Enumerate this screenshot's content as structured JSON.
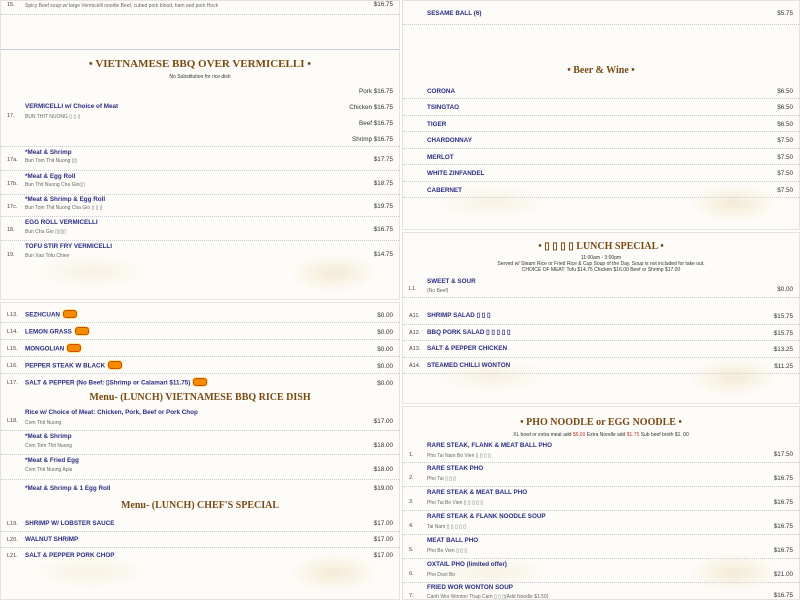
{
  "left_top": {
    "first_item": {
      "num": "15.",
      "desc": "Spicy Beef soup w/ large Vermicelli noodle Beef, cubed pork blood, ham and pork Hock",
      "price": "$16.75"
    },
    "section_title": "• VIETNAMESE BBQ OVER VERMICELLI •",
    "note": "No Substitution for rice dish",
    "item17": {
      "num": "17.",
      "name": "VERMICELLI w/ Choice of Meat",
      "sub": "BUN THIT NUONG ▯ ▯ ▯",
      "prices": [
        "Pork $16.75",
        "Chicken $16.75",
        "Beef $16.75",
        "Shrimp $16.75"
      ]
    },
    "items": [
      {
        "num": "17a.",
        "name": "*Meat & Shrimp",
        "sub": "Bun Tom Thit Nuong ▯▯",
        "price": "$17.75"
      },
      {
        "num": "17b.",
        "name": "*Meat & Egg Roll",
        "sub": "Bun Thit Nuong Cha Gio▯▯",
        "price": "$18.75"
      },
      {
        "num": "17c.",
        "name": "*Meat & Shrimp & Egg Roll",
        "sub": "Bun Tom Thit Nuong Cha Gio ▯ ▯ ▯",
        "price": "$19.75"
      },
      {
        "num": "18.",
        "name": "EGG ROLL VERMICELLI",
        "sub": "Bun Cha Gio ▯▯▯▯",
        "price": "$16.75"
      },
      {
        "num": "19.",
        "name": "TOFU STIR FRY VERMICELLI",
        "sub": "Bun Xao Tofu Chien",
        "price": "$14.75"
      }
    ]
  },
  "left_bottom": {
    "lunch_items": [
      {
        "num": "L13.",
        "name": "SEZHCUAN",
        "price": "$0.00",
        "hot": true
      },
      {
        "num": "L14.",
        "name": "LEMON GRASS",
        "price": "$0.00",
        "hot": true
      },
      {
        "num": "L15.",
        "name": "MONGOLIAN",
        "price": "$0.00",
        "hot": true
      },
      {
        "num": "L16.",
        "name": "PEPPER STEAK W BLACK",
        "price": "$0.00",
        "hot": true
      },
      {
        "num": "L17.",
        "name": "SALT & PEPPER (No Beef: ▯Shrimp or Calamari $11.75)",
        "price": "$0.00",
        "hot": true
      }
    ],
    "bbq_rice_title": "Menu- (LUNCH) VIETNAMESE BBQ RICE DISH",
    "bbq_rice_items": [
      {
        "num": "L18.",
        "name": "Rice w/ Choice of Meat: Chicken, Pork, Beef or Pork Chop",
        "sub": "Com Thit Nuong",
        "price": "$17.00"
      },
      {
        "num": "",
        "name": "*Meat & Shrimp",
        "sub": "Com Tom Thit Nuong",
        "price": "$18.00"
      },
      {
        "num": "",
        "name": "*Meat & Fried Egg",
        "sub": "Com Thit Nuong Aplа",
        "price": "$18.00"
      },
      {
        "num": "",
        "name": "*Meat & Shrimp & 1 Egg Roll",
        "sub": "",
        "price": "$19.00"
      }
    ],
    "chef_title": "Menu- (LUNCH) CHEF'S SPECIAL",
    "chef_items": [
      {
        "num": "L19.",
        "name": "SHRIMP W/ LOBSTER SAUCE",
        "price": "$17.00"
      },
      {
        "num": "L20.",
        "name": "WALNUT SHRIMP",
        "price": "$17.00"
      },
      {
        "num": "L21.",
        "name": "SALT & PEPPER PORK CHOP",
        "price": "$17.00"
      }
    ]
  },
  "right_top": {
    "first_item": {
      "name": "SESAME BALL (6)",
      "price": "$5.75"
    },
    "section_title": "• Beer & Wine •",
    "items": [
      {
        "name": "CORONA",
        "price": "$6.50"
      },
      {
        "name": "TSINGTAO",
        "price": "$6.50"
      },
      {
        "name": "TIGER",
        "price": "$6.50"
      },
      {
        "name": "CHARDONNAY",
        "price": "$7.50"
      },
      {
        "name": "MERLOT",
        "price": "$7.50"
      },
      {
        "name": "WHITE ZINFANDEL",
        "price": "$7.50"
      },
      {
        "name": "CABERNET",
        "price": "$7.50"
      }
    ]
  },
  "right_mid": {
    "section_title": "• ▯ ▯ ▯ ▯ LUNCH SPECIAL •",
    "note_line1": "11:00am - 3:00pm",
    "note_line2": "Served w/ Steam Rice or Fried Rice & Cup Soup of the Day. Soup is not included for take out.",
    "note_line3": "CHOICE OF MEAT: Tofu $14.75  Chicken $16.00  Beef or Shrimp $17.00",
    "l1": {
      "num": "L1.",
      "name": "SWEET & SOUR",
      "sub": "(No Beef)",
      "price": "$0.00"
    },
    "items": [
      {
        "num": "A11.",
        "name": "SHRIMP SALAD ▯ ▯ ▯",
        "price": "$15.75"
      },
      {
        "num": "A12.",
        "name": "BBQ PORK SALAD ▯ ▯ ▯ ▯ ▯",
        "price": "$15.75"
      },
      {
        "num": "A13.",
        "name": "SALT & PEPPER CHICKEN",
        "price": "$13.25"
      },
      {
        "num": "A14.",
        "name": "STEAMED CHILLI WONTON",
        "price": "$11.25"
      }
    ]
  },
  "right_bottom": {
    "section_title": "• PHO NOODLE or EGG NOODLE •",
    "note_pre": "XL bowl or extra meat add ",
    "note_red1": "$6.00",
    "note_mid": " Extra Noodle add ",
    "note_red2": "$1.75",
    "note_post": " Sub beef broth $1. 00",
    "items": [
      {
        "num": "1.",
        "name": "RARE STEAK, FLANK & MEAT BALL PHO",
        "sub": "Pho Tai Nam Bo Vien ▯ ▯ ▯ ▯",
        "price": "$17.50"
      },
      {
        "num": "2.",
        "name": "RARE STEAK PHO",
        "sub": "Pho Tai ▯ ▯ ▯",
        "price": "$16.75"
      },
      {
        "num": "3.",
        "name": "RARE STEAK & MEAT BALL PHO",
        "sub": "Pho Tai Bo Vien ▯ ▯ ▯ ▯ ▯",
        "price": "$16.75"
      },
      {
        "num": "4.",
        "name": "RARE STEAK & FLANK NOODLE SOUP",
        "sub": "Tai Nam ▯ ▯ ▯ ▯ ▯",
        "price": "$16.75"
      },
      {
        "num": "5.",
        "name": "MEAT BALL PHO",
        "sub": "Pho Bo Vien ▯ ▯ ▯",
        "price": "$16.75"
      },
      {
        "num": "6.",
        "name": "OXTAIL PHO (limited offer)",
        "sub": "Pho Duoi Bo",
        "price": "$21.00"
      },
      {
        "num": "7.",
        "name": "FRIED WOR WONTON SOUP",
        "sub": "Canh Wor Wonton Thap Cam ▯ ▯ ▯(Add Noodle $1.50)",
        "price": "$16.75"
      }
    ]
  }
}
